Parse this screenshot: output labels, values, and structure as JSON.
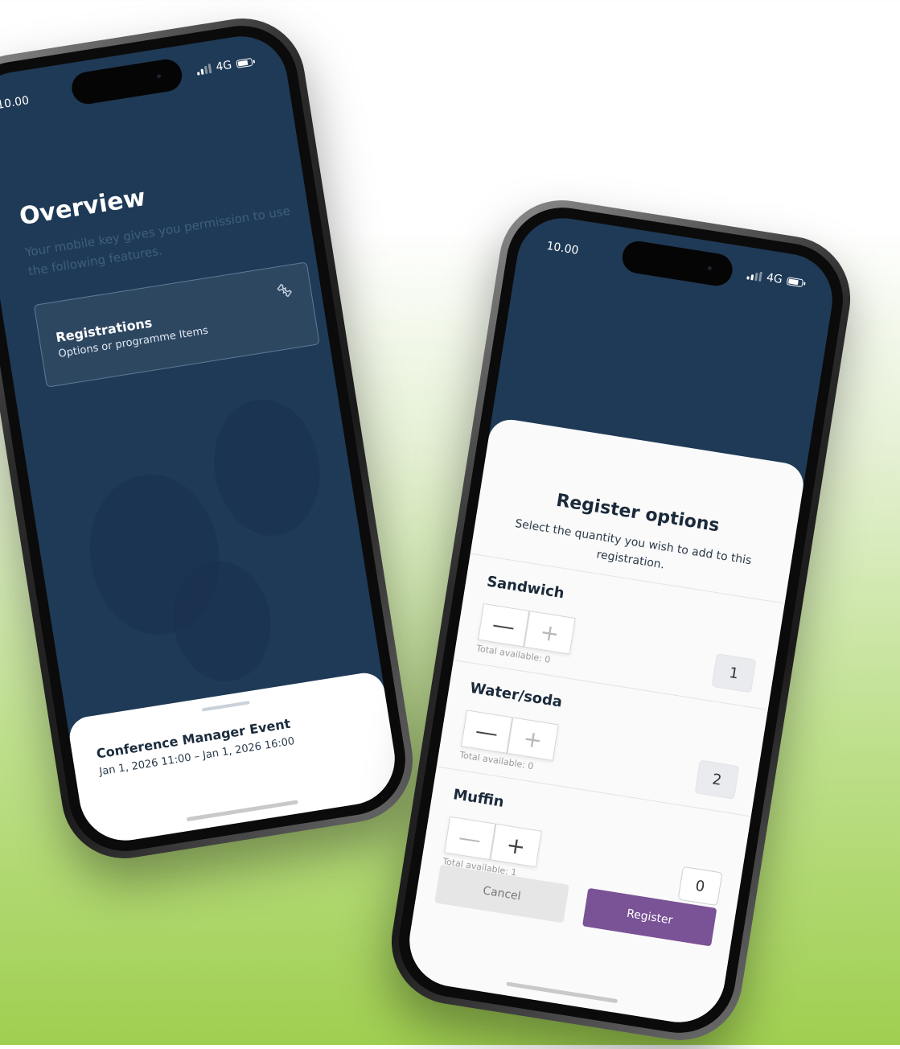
{
  "colors": {
    "screen_bg": "#1f3a56",
    "register_button": "#7a5296",
    "cancel_button": "#e6e6e6"
  },
  "overview_phone": {
    "status_time": "10.00",
    "network": "4G",
    "title": "Overview",
    "subtitle": "Your mobile key gives you permission to use the following features.",
    "card": {
      "title": "Registrations",
      "subtitle": "Options or programme Items",
      "icon": "ticket-icon"
    },
    "event": {
      "title": "Conference Manager Event",
      "dates": "Jan 1, 2026 11:00  –  Jan 1, 2026 16:00"
    }
  },
  "register_phone": {
    "status_time": "10.00",
    "network": "4G",
    "title": "Register options",
    "subtitle": "Select the quantity you wish to add to this registration.",
    "options": [
      {
        "name": "Sandwich",
        "available": "Total available: 0",
        "quantity": "1"
      },
      {
        "name": "Water/soda",
        "available": "Total available: 0",
        "quantity": "2"
      },
      {
        "name": "Muffin",
        "available": "Total available: 1",
        "quantity": "0"
      }
    ],
    "minus_symbol": "—",
    "plus_symbol": "+",
    "cancel_label": "Cancel",
    "register_label": "Register"
  }
}
